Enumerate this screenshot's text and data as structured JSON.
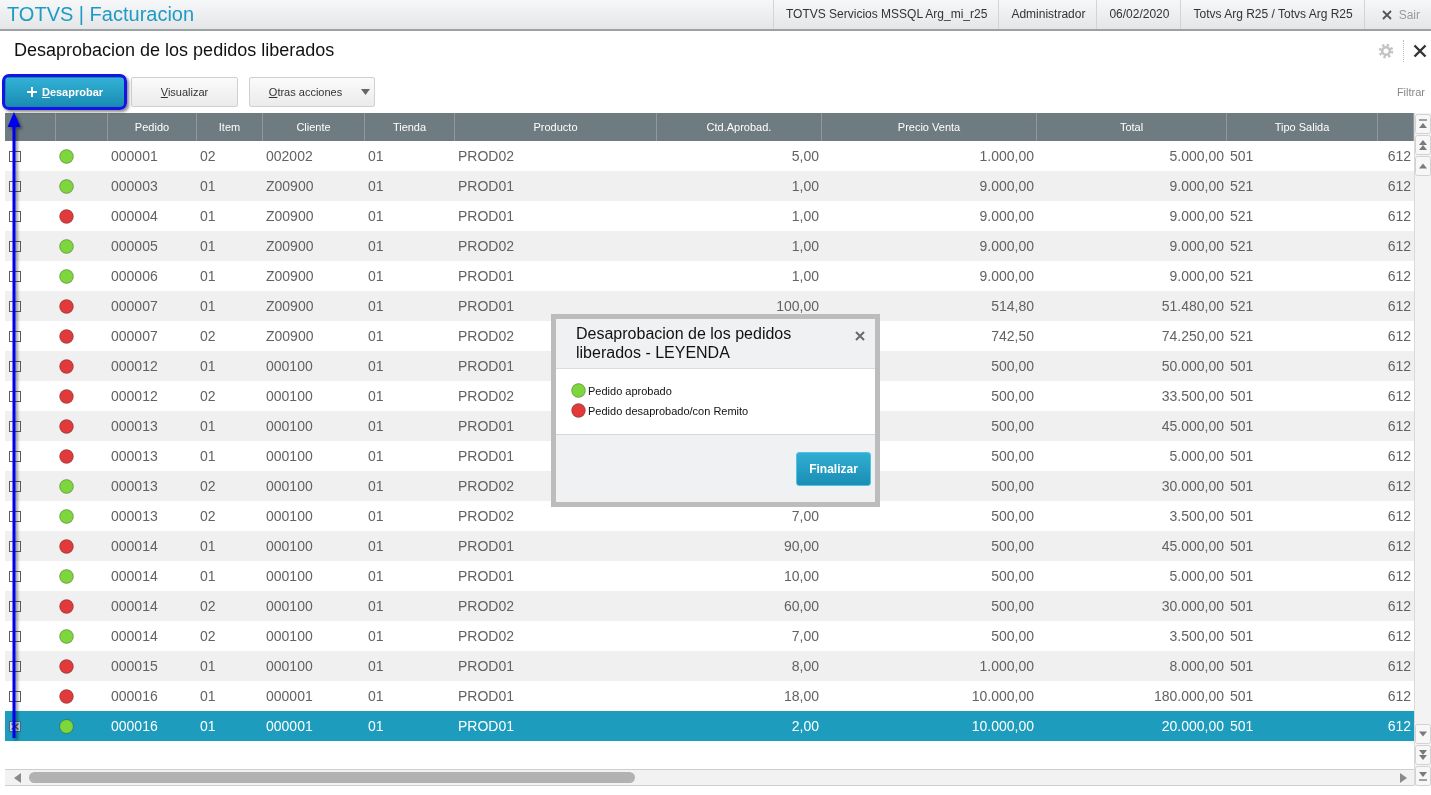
{
  "app_bar": {
    "title": "TOTVS | Facturacion",
    "items": [
      "TOTVS Servicios MSSQL Arg_mi_r25",
      "Administrador",
      "06/02/2020",
      "Totvs Arg R25 / Totvs Arg R25"
    ],
    "logout": "Sair"
  },
  "page": {
    "title": "Desaprobacion de los pedidos liberados"
  },
  "toolbar": {
    "buttons": [
      {
        "label": "Desaprobar",
        "kind": "primary"
      },
      {
        "label": "Visualizar",
        "kind": "plain"
      },
      {
        "label": "Otras acciones",
        "kind": "dropdown"
      }
    ],
    "filter_link": "Filtrar"
  },
  "table": {
    "columns": [
      "Pedido",
      "Item",
      "Cliente",
      "Tienda",
      "Producto",
      "Ctd.Aprobad.",
      "Precio Venta",
      "Total",
      "Tipo Salida"
    ],
    "rows": [
      {
        "checked": false,
        "selected": false,
        "color": "#7dd63b",
        "pedido": "000001",
        "item": "02",
        "cliente": "002002",
        "tienda": "01",
        "producto": "PROD02",
        "ctd_aprobad": "5,00",
        "precio_venta": "1.000,00",
        "total": "5.000,00",
        "tipo_salida": "501",
        "column_12": "612"
      },
      {
        "checked": false,
        "selected": false,
        "color": "#7dd63b",
        "pedido": "000003",
        "item": "01",
        "cliente": "Z00900",
        "tienda": "01",
        "producto": "PROD01",
        "ctd_aprobad": "1,00",
        "precio_venta": "9.000,00",
        "total": "9.000,00",
        "tipo_salida": "521",
        "column_12": "612"
      },
      {
        "checked": false,
        "selected": false,
        "color": "#e23a3a",
        "pedido": "000004",
        "item": "01",
        "cliente": "Z00900",
        "tienda": "01",
        "producto": "PROD01",
        "ctd_aprobad": "1,00",
        "precio_venta": "9.000,00",
        "total": "9.000,00",
        "tipo_salida": "521",
        "column_12": "612"
      },
      {
        "checked": false,
        "selected": false,
        "color": "#7dd63b",
        "pedido": "000005",
        "item": "01",
        "cliente": "Z00900",
        "tienda": "01",
        "producto": "PROD02",
        "ctd_aprobad": "1,00",
        "precio_venta": "9.000,00",
        "total": "9.000,00",
        "tipo_salida": "521",
        "column_12": "612"
      },
      {
        "checked": false,
        "selected": false,
        "color": "#7dd63b",
        "pedido": "000006",
        "item": "01",
        "cliente": "Z00900",
        "tienda": "01",
        "producto": "PROD01",
        "ctd_aprobad": "1,00",
        "precio_venta": "9.000,00",
        "total": "9.000,00",
        "tipo_salida": "521",
        "column_12": "612"
      },
      {
        "checked": false,
        "selected": false,
        "color": "#e23a3a",
        "pedido": "000007",
        "item": "01",
        "cliente": "Z00900",
        "tienda": "01",
        "producto": "PROD01",
        "ctd_aprobad": "100,00",
        "precio_venta": "514,80",
        "total": "51.480,00",
        "tipo_salida": "521",
        "column_12": "612"
      },
      {
        "checked": false,
        "selected": false,
        "color": "#e23a3a",
        "pedido": "000007",
        "item": "02",
        "cliente": "Z00900",
        "tienda": "01",
        "producto": "PROD02",
        "precio_venta": "742,50",
        "total": "74.250,00",
        "tipo_salida": "521",
        "column_12": "612"
      },
      {
        "checked": false,
        "selected": false,
        "color": "#e23a3a",
        "pedido": "000012",
        "item": "01",
        "cliente": "000100",
        "tienda": "01",
        "producto": "PROD01",
        "precio_venta": "500,00",
        "total": "50.000,00",
        "tipo_salida": "501",
        "column_12": "612"
      },
      {
        "checked": false,
        "selected": false,
        "color": "#e23a3a",
        "pedido": "000012",
        "item": "02",
        "cliente": "000100",
        "tienda": "01",
        "producto": "PROD02",
        "precio_venta": "500,00",
        "total": "33.500,00",
        "tipo_salida": "501",
        "column_12": "612"
      },
      {
        "checked": false,
        "selected": false,
        "color": "#e23a3a",
        "pedido": "000013",
        "item": "01",
        "cliente": "000100",
        "tienda": "01",
        "producto": "PROD01",
        "precio_venta": "500,00",
        "total": "45.000,00",
        "tipo_salida": "501",
        "column_12": "612"
      },
      {
        "checked": false,
        "selected": false,
        "color": "#e23a3a",
        "pedido": "000013",
        "item": "01",
        "cliente": "000100",
        "tienda": "01",
        "producto": "PROD01",
        "precio_venta": "500,00",
        "total": "5.000,00",
        "tipo_salida": "501",
        "column_12": "612"
      },
      {
        "checked": false,
        "selected": false,
        "color": "#7dd63b",
        "pedido": "000013",
        "item": "02",
        "cliente": "000100",
        "tienda": "01",
        "producto": "PROD02",
        "precio_venta": "500,00",
        "total": "30.000,00",
        "tipo_salida": "501",
        "column_12": "612"
      },
      {
        "checked": false,
        "selected": false,
        "color": "#7dd63b",
        "pedido": "000013",
        "item": "02",
        "cliente": "000100",
        "tienda": "01",
        "producto": "PROD02",
        "ctd_aprobad": "7,00",
        "precio_venta": "500,00",
        "total": "3.500,00",
        "tipo_salida": "501",
        "column_12": "612"
      },
      {
        "checked": false,
        "selected": false,
        "color": "#e23a3a",
        "pedido": "000014",
        "item": "01",
        "cliente": "000100",
        "tienda": "01",
        "producto": "PROD01",
        "ctd_aprobad": "90,00",
        "precio_venta": "500,00",
        "total": "45.000,00",
        "tipo_salida": "501",
        "column_12": "612"
      },
      {
        "checked": false,
        "selected": false,
        "color": "#7dd63b",
        "pedido": "000014",
        "item": "01",
        "cliente": "000100",
        "tienda": "01",
        "producto": "PROD01",
        "ctd_aprobad": "10,00",
        "precio_venta": "500,00",
        "total": "5.000,00",
        "tipo_salida": "501",
        "column_12": "612"
      },
      {
        "checked": false,
        "selected": false,
        "color": "#e23a3a",
        "pedido": "000014",
        "item": "02",
        "cliente": "000100",
        "tienda": "01",
        "producto": "PROD02",
        "ctd_aprobad": "60,00",
        "precio_venta": "500,00",
        "total": "30.000,00",
        "tipo_salida": "501",
        "column_12": "612"
      },
      {
        "checked": false,
        "selected": false,
        "color": "#7dd63b",
        "pedido": "000014",
        "item": "02",
        "cliente": "000100",
        "tienda": "01",
        "producto": "PROD02",
        "ctd_aprobad": "7,00",
        "precio_venta": "500,00",
        "total": "3.500,00",
        "tipo_salida": "501",
        "column_12": "612"
      },
      {
        "checked": false,
        "selected": false,
        "color": "#e23a3a",
        "pedido": "000015",
        "item": "01",
        "cliente": "000100",
        "tienda": "01",
        "producto": "PROD01",
        "ctd_aprobad": "8,00",
        "precio_venta": "1.000,00",
        "total": "8.000,00",
        "tipo_salida": "501",
        "column_12": "612"
      },
      {
        "checked": false,
        "selected": false,
        "color": "#e23a3a",
        "pedido": "000016",
        "item": "01",
        "cliente": "000001",
        "tienda": "01",
        "producto": "PROD01",
        "ctd_aprobad": "18,00",
        "precio_venta": "10.000,00",
        "total": "180.000,00",
        "tipo_salida": "501",
        "column_12": "612"
      },
      {
        "checked": true,
        "selected": true,
        "color": "#7dd63b",
        "pedido": "000016",
        "item": "01",
        "cliente": "000001",
        "tienda": "01",
        "producto": "PROD01",
        "ctd_aprobad": "2,00",
        "precio_venta": "10.000,00",
        "total": "20.000,00",
        "tipo_salida": "501",
        "column_12": "612"
      }
    ]
  },
  "legend_dialog": {
    "title": "Desaprobacion de los pedidos liberados - LEYENDA",
    "items": [
      {
        "label": "Pedido aprobado",
        "color": "#7dd63b"
      },
      {
        "label": "Pedido desaprobado/con Remito",
        "color": "#e23a3a"
      }
    ],
    "button": "Finalizar"
  }
}
